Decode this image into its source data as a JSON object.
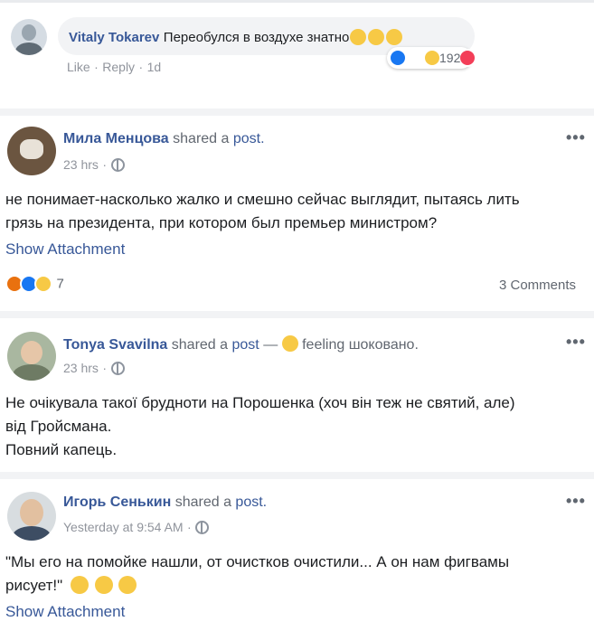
{
  "comment": {
    "author": "Vitaly Tokarev",
    "text": "Переобулся в воздухе знатно",
    "like": "Like",
    "reply": "Reply",
    "age": "1d",
    "reaction_count": "192",
    "avatar_colors": [
      "#c9d2da",
      "#7c8a96"
    ]
  },
  "posts": [
    {
      "author": "Мила Менцова",
      "action": "shared a",
      "action_link": "post.",
      "time": "23 hrs",
      "body_lines": [
        "не понимает-насколько жалко и смешно сейчас выглядит, пытаясь лить",
        "грязь на президента, при котором был премьер министром?"
      ],
      "show_attachment": "Show Attachment",
      "reaction_count": "7",
      "comments": "3 Comments"
    },
    {
      "author": "Tonya Svavilna",
      "action": "shared a",
      "action_link": "post",
      "dash": "—",
      "feeling": "feeling шоковано.",
      "time": "23 hrs",
      "body_lines": [
        "Не очікувала такої брудноти на Порошенка (хоч він теж не святий, але)",
        "від Гройсмана.",
        "Повний капець."
      ]
    },
    {
      "author": "Игорь Сенькин",
      "action": "shared a",
      "action_link": "post.",
      "time": "Yesterday at 9:54 AM",
      "body_lines": [
        "\"Мы его на помойке нашли, от очистков очистили... А он нам фигвамы",
        "рисует!\""
      ],
      "show_attachment": "Show Attachment"
    }
  ],
  "more_label": "•••",
  "dot": "·",
  "colors": {
    "link": "#385898",
    "meta": "#90949c",
    "like_blue": "#1877f2",
    "haha_yellow": "#f7c945",
    "love_red": "#f33e58",
    "angry_orange": "#e9710f"
  }
}
